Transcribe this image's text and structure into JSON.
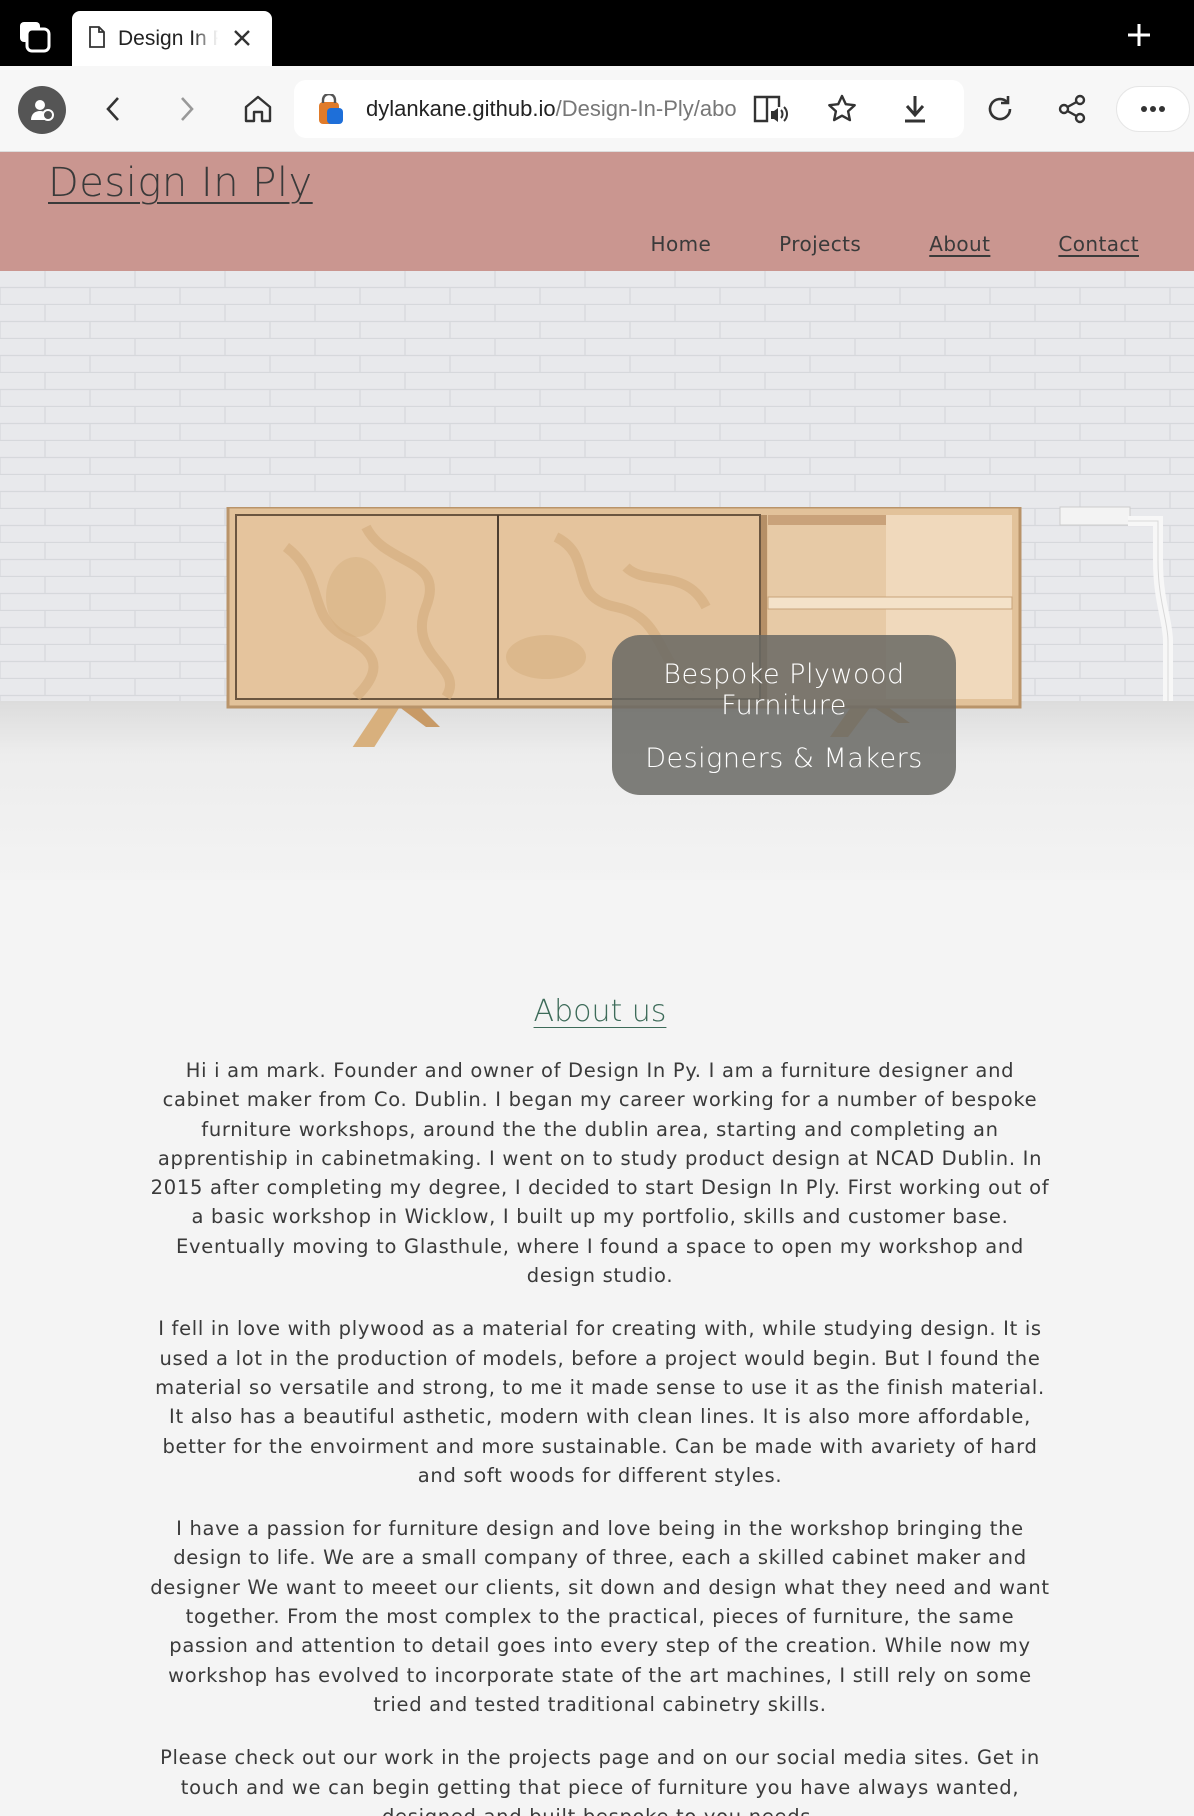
{
  "browser": {
    "tab_title": "Design In Ply",
    "url_domain": "dylankane.github.io",
    "url_path": "/Design-In-Ply/about"
  },
  "site": {
    "logo": "Design In Ply",
    "nav": [
      {
        "label": "Home"
      },
      {
        "label": "Projects"
      },
      {
        "label": "About"
      },
      {
        "label": "Contact"
      }
    ]
  },
  "hero": {
    "line1": "Bespoke Plywood Furniture",
    "line2": "Designers & Makers"
  },
  "about": {
    "title": "About us",
    "paragraphs": [
      "Hi i am mark. Founder and owner of Design In Py. I am a furniture designer and cabinet maker from Co. Dublin. I began my career working for a number of bespoke furniture workshops, around the the dublin area, starting and completing an apprentiship in cabinetmaking. I went on to study product design at NCAD Dublin. In 2015 after completing my degree, I decided to start Design In Ply. First working out of a basic workshop in Wicklow, I built up my portfolio, skills and customer base. Eventually moving to Glasthule, where I found a space to open my workshop and design studio.",
      "I fell in love with plywood as a material for creating with, while studying design. It is used a lot in the production of models, before a project would begin. But I found the material so versatile and strong, to me it made sense to use it as the finish material. It also has a beautiful asthetic, modern with clean lines. It is also more affordable, better for the envoirment and more sustainable. Can be made with avariety of hard and soft woods for different styles.",
      "I have a passion for furniture design and love being in the workshop bringing the design to life. We are a small company of three, each a skilled cabinet maker and designer We want to meeet our clients, sit down and design what they need and want together. From the most complex to the practical, pieces of furniture, the same passion and attention to detail goes into every step of the creation. While now my workshop has evolved to incorporate state of the art machines, I still rely on some tried and tested traditional cabinetry skills.",
      "Please check out our work in the projects page and on our social media sites. Get in touch and we can begin getting that piece of furniture you have always wanted, designed and built bespoke to you needs."
    ]
  }
}
